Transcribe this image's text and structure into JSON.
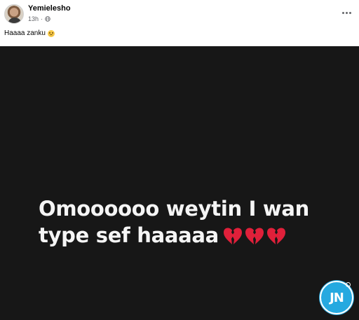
{
  "post": {
    "author": "Yemielesho",
    "time": "13h",
    "privacy_icon": "globe-icon",
    "caption": "Haaaa zanku",
    "caption_emoji": "sad-face-emoji",
    "menu_icon": "more-options-icon"
  },
  "media": {
    "line1": "Omoooooo weytin I wan",
    "line2": "type sef haaaaa",
    "emoji": [
      "broken-heart",
      "broken-heart",
      "broken-heart"
    ],
    "background_color": "#171717",
    "text_color": "#f5f5f5",
    "watermark": "JN"
  },
  "colors": {
    "heart": "#e0203a",
    "watermark": "#25a9e0"
  }
}
